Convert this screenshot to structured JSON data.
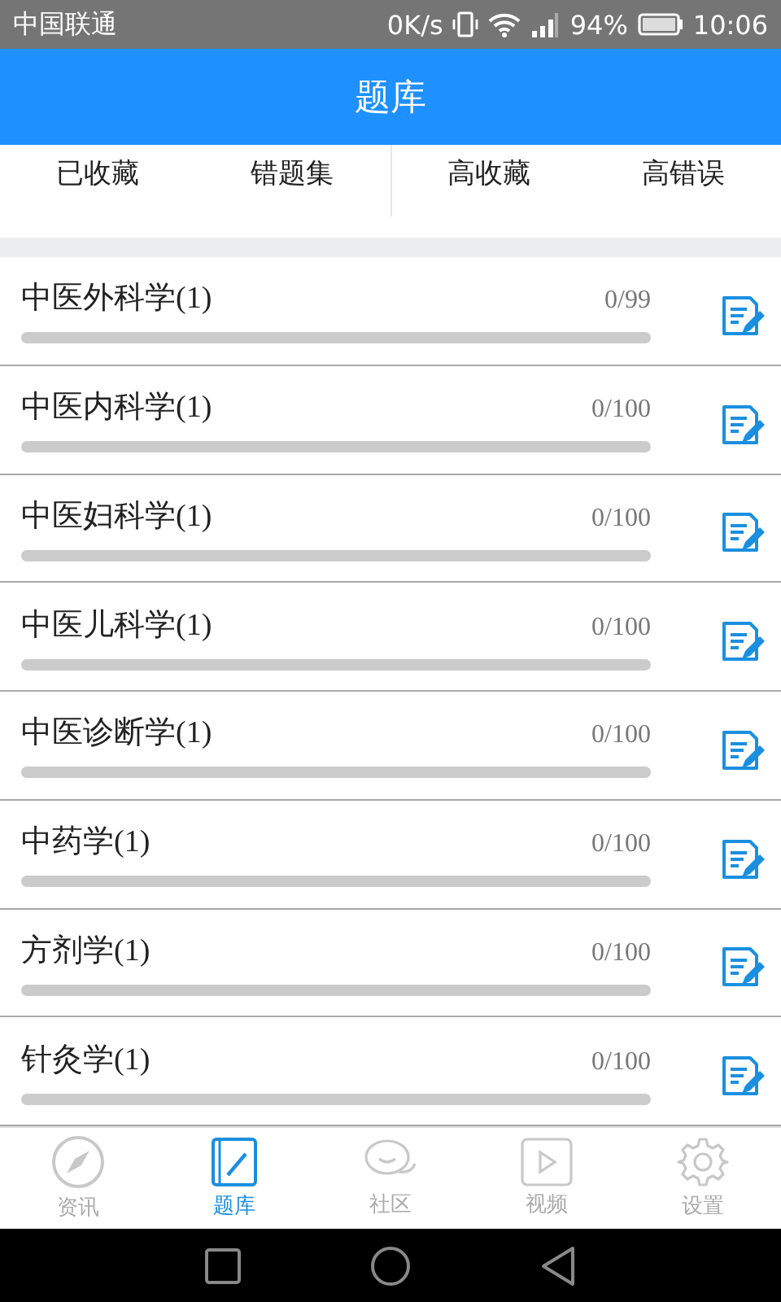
{
  "status_bar": {
    "carrier": "中国联通",
    "speed": "0K/s",
    "battery": "94%",
    "time": "10:06"
  },
  "header": {
    "title": "题库"
  },
  "filters": [
    {
      "label": "已收藏"
    },
    {
      "label": "错题集"
    },
    {
      "label": "高收藏"
    },
    {
      "label": "高错误"
    }
  ],
  "subjects": [
    {
      "name": "中医外科学(1)",
      "progress": "0/99",
      "level": 0
    },
    {
      "name": "中医内科学(1)",
      "progress": "0/100",
      "level": 0
    },
    {
      "name": "中医妇科学(1)",
      "progress": "0/100",
      "level": 0
    },
    {
      "name": "中医儿科学(1)",
      "progress": "0/100",
      "level": 0
    },
    {
      "name": "中医诊断学(1)",
      "progress": "0/100",
      "level": 0
    },
    {
      "name": "中药学(1)",
      "progress": "0/100",
      "level": 0
    },
    {
      "name": "方剂学(1)",
      "progress": "0/100",
      "level": 0
    },
    {
      "name": "针灸学(1)",
      "progress": "0/100",
      "level": 0
    }
  ],
  "bottom_nav": [
    {
      "label": "资讯",
      "kind": "compass",
      "selected": false
    },
    {
      "label": "题库",
      "kind": "notebook",
      "selected": true
    },
    {
      "label": "社区",
      "kind": "chat",
      "selected": false
    },
    {
      "label": "视频",
      "kind": "video",
      "selected": false
    },
    {
      "label": "设置",
      "kind": "gear",
      "selected": false
    }
  ]
}
